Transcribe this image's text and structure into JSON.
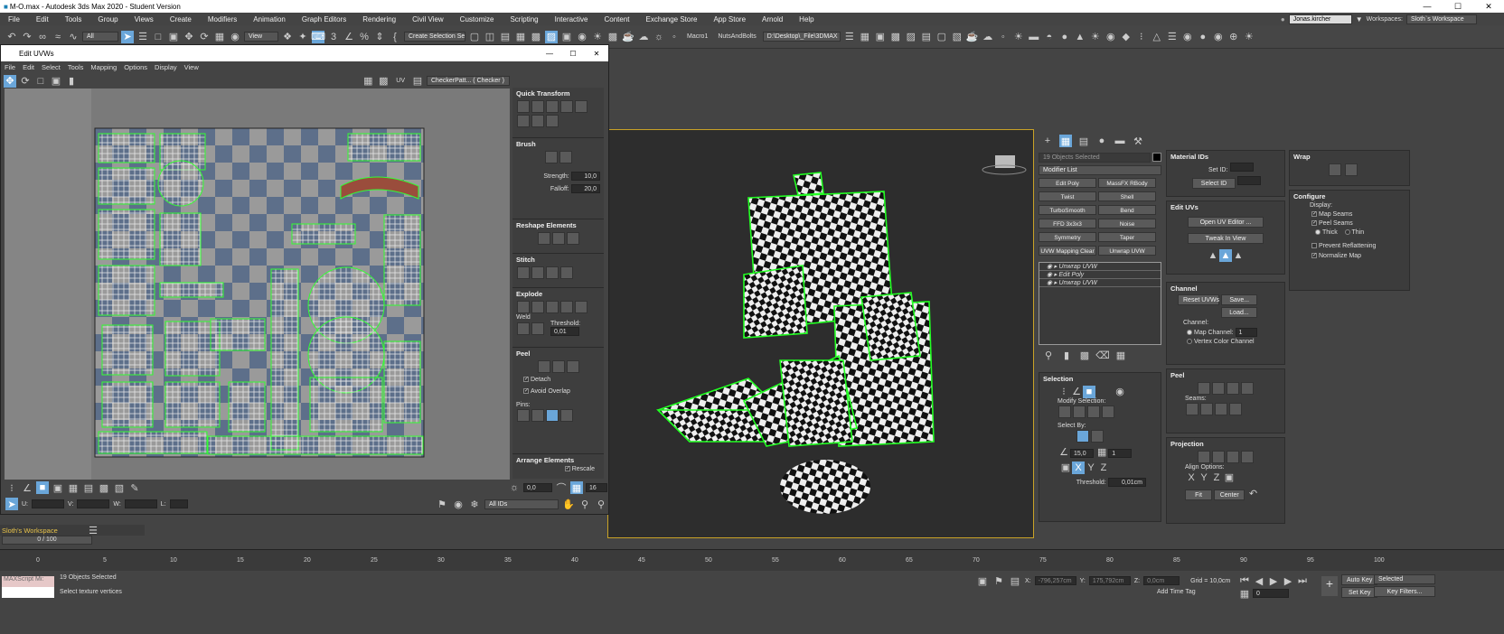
{
  "app": {
    "title": "M-O.max - Autodesk 3ds Max 2020 - Student Version"
  },
  "window_controls": {
    "minimize": "—",
    "maximize": "☐",
    "close": "✕"
  },
  "menu": [
    "File",
    "Edit",
    "Tools",
    "Group",
    "Views",
    "Create",
    "Modifiers",
    "Animation",
    "Graph Editors",
    "Rendering",
    "Civil View",
    "Customize",
    "Scripting",
    "Interactive",
    "Content",
    "Exchange Store",
    "App Store",
    "Arnold",
    "Help"
  ],
  "user": {
    "name": "Jonas.kircher",
    "workspace_label": "Workspaces:",
    "workspace": "Sloth`s Workspace"
  },
  "toolbar": {
    "filter": "All",
    "ref_coord": "View",
    "selection_set": "Create Selection Se",
    "macro1": "Macro1",
    "nuts": "NutsAndBolts",
    "path": "D:\\Desktop\\_File\\3DMAX"
  },
  "uv_editor": {
    "title": "Edit UVWs",
    "menu": [
      "File",
      "Edit",
      "Select",
      "Tools",
      "Mapping",
      "Options",
      "Display",
      "View"
    ],
    "uv_label": "UV",
    "texture": "CheckerPatt... ( Checker )",
    "sections": {
      "quick_transform": "Quick Transform",
      "brush": "Brush",
      "reshape": "Reshape Elements",
      "stitch": "Stitch",
      "explode": "Explode",
      "peel": "Peel",
      "arrange": "Arrange Elements"
    },
    "brush": {
      "strength_label": "Strength:",
      "strength": "10,0",
      "falloff_label": "Falloff:",
      "falloff": "20,0"
    },
    "explode": {
      "weld": "Weld",
      "threshold_label": "Threshold:",
      "threshold": "0,01"
    },
    "peel": {
      "detach": "Detach",
      "avoid_overlap": "Avoid Overlap",
      "pins": "Pins:"
    },
    "arrange": {
      "rescale": "Rescale"
    },
    "bottom": {
      "u": "U:",
      "v": "V:",
      "w": "W:",
      "l": "L:",
      "angle": "0,0",
      "xy": "XY",
      "val16": "16",
      "ids": "All IDs"
    }
  },
  "workspace_bar": {
    "name": "Sloth's Workspace"
  },
  "command_panel": {
    "objects_selected": "19 Objects Selected",
    "modifier_list": "Modifier List",
    "modifiers": [
      "Edit Poly",
      "MassFX RBody",
      "Twist",
      "Shell",
      "TurboSmooth",
      "Bend",
      "FFD 3x3x3",
      "Noise",
      "Symmetry",
      "Taper",
      "UVW Mapping Clear",
      "Unwrap UVW"
    ],
    "stack": [
      "Unwrap UVW",
      "Edit Poly",
      "Unwrap UVW"
    ],
    "selection": {
      "title": "Selection",
      "modify": "Modify Selection:",
      "select_by": "Select By:",
      "angle": "15,0",
      "count": "1",
      "threshold_label": "Threshold:",
      "threshold": "0,01cm"
    }
  },
  "material_ids": {
    "title": "Material IDs",
    "set_id": "Set ID:",
    "select_id": "Select ID"
  },
  "edit_uvs": {
    "title": "Edit UVs",
    "open": "Open UV Editor ...",
    "tweak": "Tweak In View"
  },
  "channel": {
    "title": "Channel",
    "reset": "Reset UVWs",
    "save": "Save...",
    "load": "Load...",
    "channel_label": "Channel:",
    "map_channel": "Map Channel:",
    "map_channel_value": "1",
    "vertex_color": "Vertex Color Channel"
  },
  "peel_panel": {
    "title": "Peel",
    "seams": "Seams:"
  },
  "projection": {
    "title": "Projection",
    "align": "Align Options:",
    "x": "X",
    "y": "Y",
    "z": "Z",
    "fit": "Fit",
    "center": "Center"
  },
  "wrap": {
    "title": "Wrap"
  },
  "configure": {
    "title": "Configure",
    "display": "Display:",
    "map_seams": "Map Seams",
    "peel_seams": "Peel Seams",
    "thick": "Thick",
    "thin": "Thin",
    "prevent": "Prevent Reflattening",
    "normalize": "Normalize Map"
  },
  "timeline": {
    "frame": "0 / 100",
    "ticks": [
      "0",
      "5",
      "10",
      "15",
      "20",
      "25",
      "30",
      "35",
      "40",
      "45",
      "50",
      "55",
      "60",
      "65",
      "70",
      "75",
      "80",
      "85",
      "90",
      "95",
      "100"
    ]
  },
  "status": {
    "maxscript": "MAXScript Mi:",
    "selected": "19 Objects Selected",
    "prompt": "Select texture vertices",
    "x_label": "X:",
    "x": "-796,257cm",
    "y_label": "Y:",
    "y": "175,792cm",
    "z_label": "Z:",
    "z": "0,0cm",
    "grid": "Grid = 10,0cm",
    "add_time_tag": "Add Time Tag",
    "auto_key": "Auto Key",
    "set_key": "Set Key",
    "selected_dd": "Selected",
    "key_filters": "Key Filters...",
    "frame": "0"
  }
}
